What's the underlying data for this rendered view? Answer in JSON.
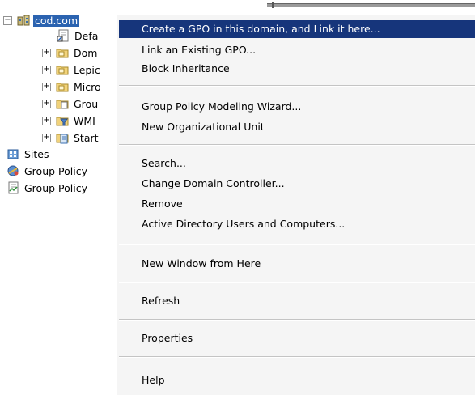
{
  "tree": {
    "root_label": "cod.com",
    "children": [
      {
        "label": "Defa"
      },
      {
        "label": "Dom"
      },
      {
        "label": "Lepic"
      },
      {
        "label": "Micro"
      },
      {
        "label": "Grou"
      },
      {
        "label": "WMI"
      },
      {
        "label": "Start"
      }
    ],
    "siblings": [
      {
        "label": "Sites"
      },
      {
        "label": "Group Policy"
      },
      {
        "label": "Group Policy"
      }
    ]
  },
  "menu": {
    "items": [
      {
        "label": "Create a GPO in this domain, and Link it here..."
      },
      {
        "label": "Link an Existing GPO..."
      },
      {
        "label": "Block Inheritance"
      },
      {
        "label": "Group Policy Modeling Wizard..."
      },
      {
        "label": "New Organizational Unit"
      },
      {
        "label": "Search..."
      },
      {
        "label": "Change Domain Controller..."
      },
      {
        "label": "Remove"
      },
      {
        "label": "Active Directory Users and Computers..."
      },
      {
        "label": "New Window from Here"
      },
      {
        "label": "Refresh"
      },
      {
        "label": "Properties"
      },
      {
        "label": "Help"
      }
    ]
  },
  "colors": {
    "selection": "#2b63b0",
    "menu_highlight": "#16357b",
    "menu_bg": "#f5f5f5"
  }
}
